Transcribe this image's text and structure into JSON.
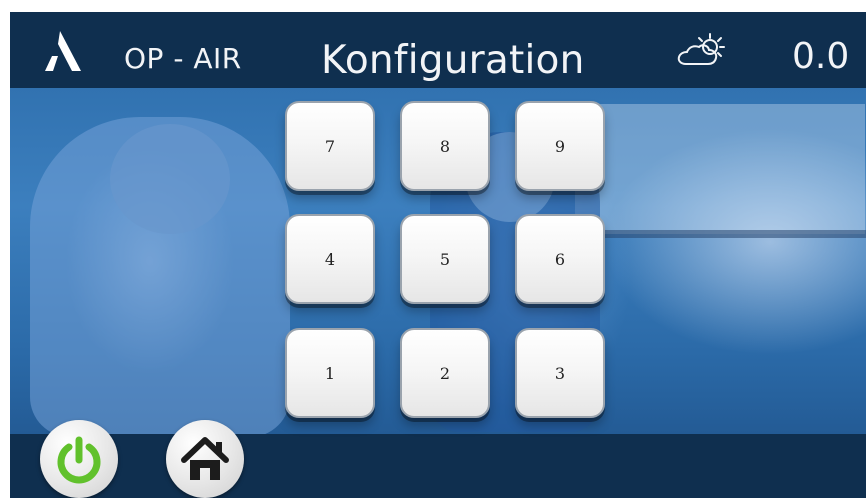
{
  "header": {
    "brand": "OP - AIR",
    "title": "Konfiguration",
    "value": "0.0",
    "logo_icon": "stylized-a-logo-icon",
    "weather_icon": "partly-sunny-icon"
  },
  "keypad": {
    "rows": [
      [
        "7",
        "8",
        "9"
      ],
      [
        "4",
        "5",
        "6"
      ],
      [
        "1",
        "2",
        "3"
      ]
    ]
  },
  "bottom": {
    "power_icon": "power-icon",
    "home_icon": "home-icon"
  },
  "colors": {
    "bar": "#0f2f4f",
    "power_green": "#61c12c",
    "key_border": "#9aa3ad"
  }
}
